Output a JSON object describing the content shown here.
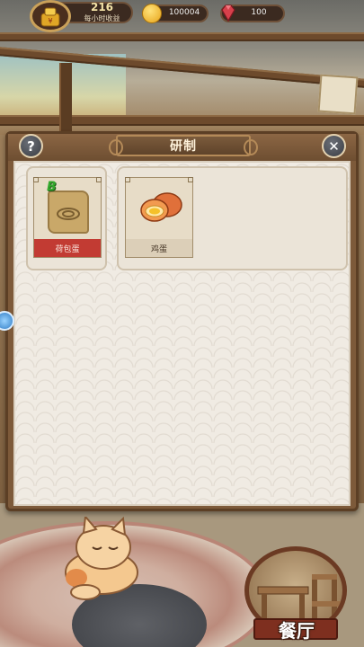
{
  "hud": {
    "income_value": "216",
    "income_label": "每小时收益",
    "gold": "100004",
    "gems": "100"
  },
  "dialog": {
    "title": "研制",
    "help_symbol": "?",
    "close_symbol": "✕"
  },
  "recipes": [
    {
      "grade": "B",
      "name": "荷包蛋",
      "icon": "scroll-recipe-icon",
      "state": "locked"
    },
    {
      "name": "鸡蛋",
      "icon": "egg-icon",
      "state": "available"
    }
  ],
  "bottom_nav": {
    "restaurant_label": "餐厅"
  },
  "colors": {
    "locked_label": "#c23b33",
    "frame_wood": "#7d5a3a",
    "grade_green": "#34a82d"
  }
}
